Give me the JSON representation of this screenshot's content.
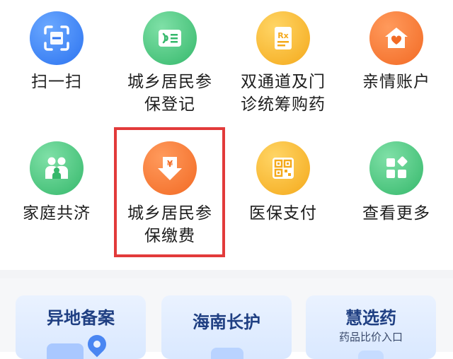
{
  "grid_items": [
    {
      "label_line1": "扫一扫",
      "label_line2": "",
      "icon": "scan-icon",
      "color": "#2c73f0"
    },
    {
      "label_line1": "城乡居民参",
      "label_line2": "保登记",
      "icon": "register-card-icon",
      "color": "#35b86b"
    },
    {
      "label_line1": "双通道及门",
      "label_line2": "诊统筹购药",
      "icon": "prescription-icon",
      "color": "#f4a91b"
    },
    {
      "label_line1": "亲情账户",
      "label_line2": "",
      "icon": "home-heart-icon",
      "color": "#f26a24"
    },
    {
      "label_line1": "家庭共济",
      "label_line2": "",
      "icon": "family-icon",
      "color": "#35b86b"
    },
    {
      "label_line1": "城乡居民参",
      "label_line2": "保缴费",
      "icon": "yuan-payment-icon",
      "color": "#f26a24"
    },
    {
      "label_line1": "医保支付",
      "label_line2": "",
      "icon": "qr-code-icon",
      "color": "#f4a91b"
    },
    {
      "label_line1": "查看更多",
      "label_line2": "",
      "icon": "more-apps-icon",
      "color": "#35b86b"
    }
  ],
  "cards": [
    {
      "title": "异地备案",
      "subtitle": ""
    },
    {
      "title": "海南长护",
      "subtitle": ""
    },
    {
      "title": "慧选药",
      "subtitle": "药品比价入口"
    }
  ],
  "highlight_color": "#e23a3a"
}
